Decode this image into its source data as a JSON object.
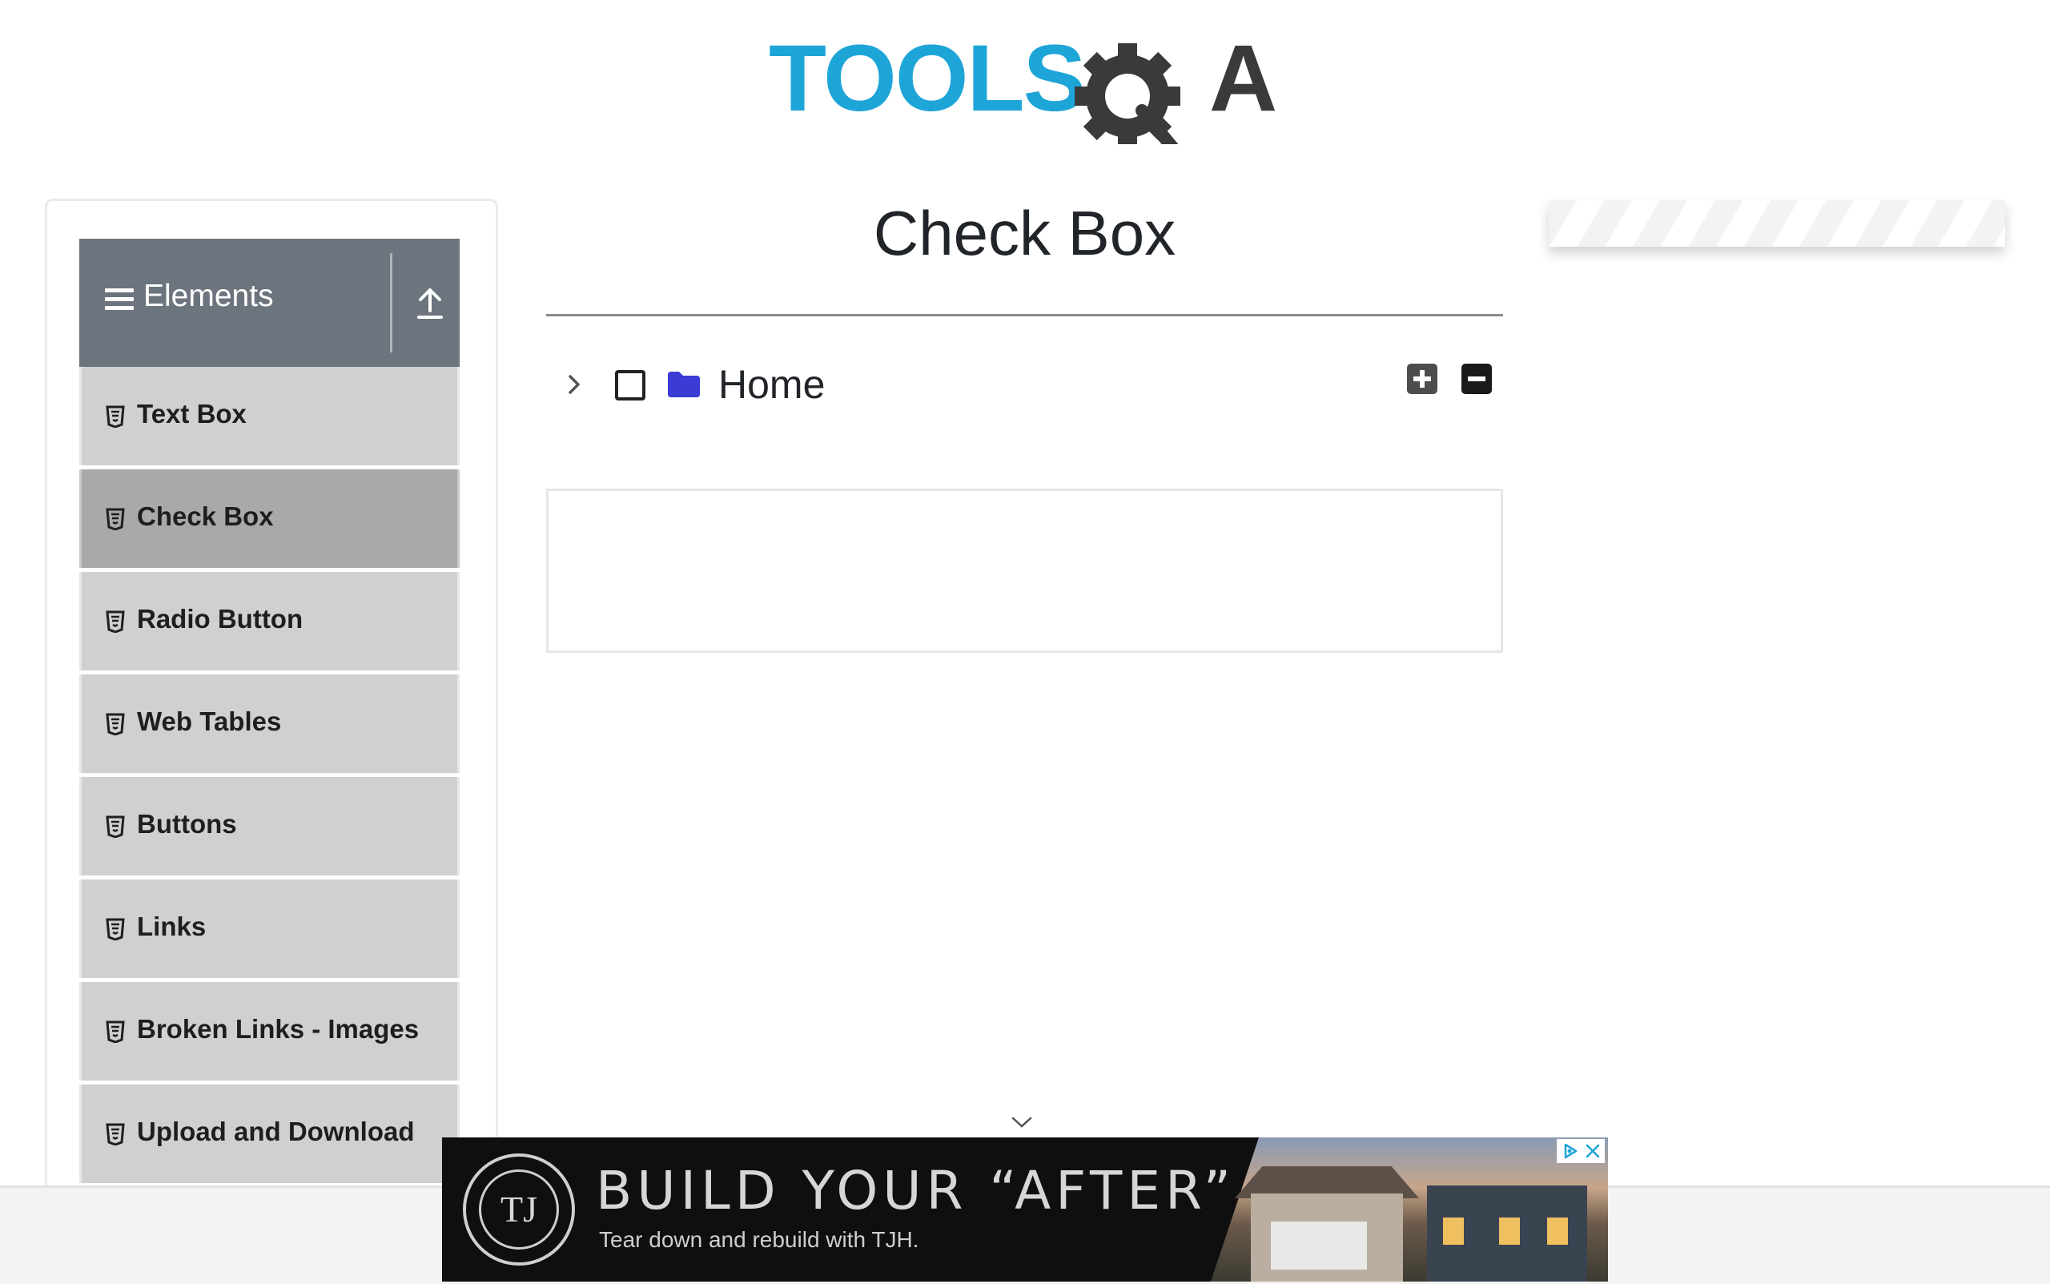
{
  "logo": {
    "text_left": "TOOLS",
    "text_right": "A"
  },
  "sidebar": {
    "group_title": "Elements",
    "items": [
      {
        "label": "Text Box",
        "active": false
      },
      {
        "label": "Check Box",
        "active": true
      },
      {
        "label": "Radio Button",
        "active": false
      },
      {
        "label": "Web Tables",
        "active": false
      },
      {
        "label": "Buttons",
        "active": false
      },
      {
        "label": "Links",
        "active": false
      },
      {
        "label": "Broken Links - Images",
        "active": false
      },
      {
        "label": "Upload and Download",
        "active": false
      }
    ]
  },
  "main": {
    "page_title": "Check Box",
    "tree": {
      "root_label": "Home",
      "checked": false,
      "expanded": false
    }
  },
  "ad": {
    "logo_text": "TJ",
    "headline": "BUILD YOUR “AFTER”",
    "subline": "Tear down and rebuild with TJH."
  },
  "colors": {
    "logo_blue": "#1ea5d8",
    "logo_gray": "#3a3a3a",
    "sidebar_header": "#6c757d",
    "menu_item_bg": "#d0d0d0",
    "menu_item_active_bg": "#a9a9a9",
    "folder_icon": "#3b3bd6"
  },
  "icons": {
    "menu": "hamburger-icon",
    "collapse_group": "upload-arrow-icon",
    "menu_item": "html5-shield-icon",
    "tree_toggle": "chevron-right-icon",
    "folder": "folder-icon",
    "expand_all": "plus-square-icon",
    "collapse_all": "minus-square-icon"
  }
}
